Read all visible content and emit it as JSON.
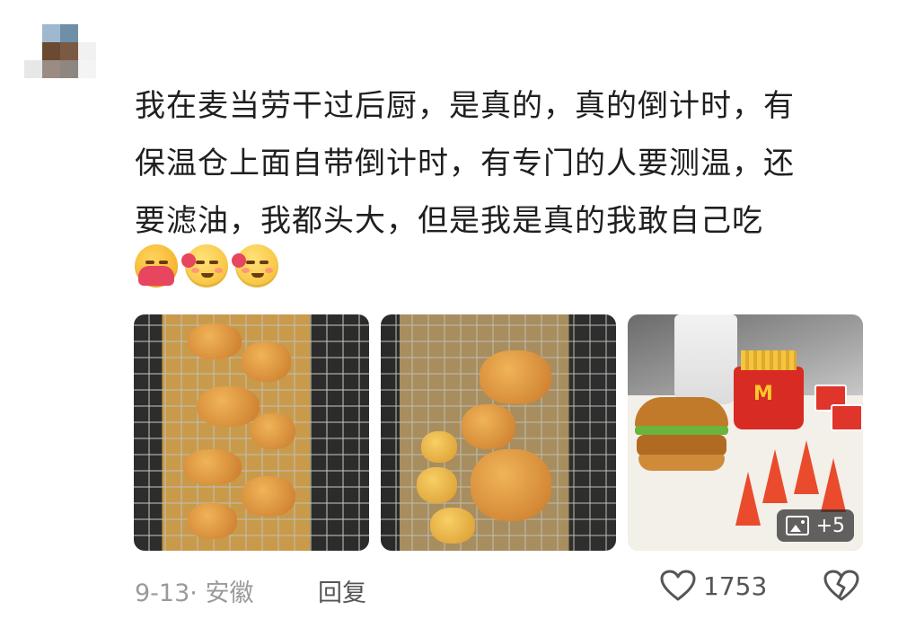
{
  "comment": {
    "text_lines": [
      "我在麦当劳干过后厨，是真的，真的倒计时，有",
      "保温仓上面自带倒计时，有专门的人要测温，还",
      "要滤油，我都头大，但是我是真的我敢自己吃"
    ],
    "emojis": [
      "hug-emoji",
      "salute-blush-emoji",
      "salute-blush-emoji"
    ],
    "images": {
      "more_count": "+5"
    },
    "meta": {
      "date_location": "9-13· 安徽",
      "reply_label": "回复",
      "like_count": "1753"
    }
  },
  "colors": {
    "text": "#1f1f1f",
    "meta": "#9a9a9a",
    "mcd_red": "#d82b23",
    "mcd_yellow": "#ffc72c"
  }
}
